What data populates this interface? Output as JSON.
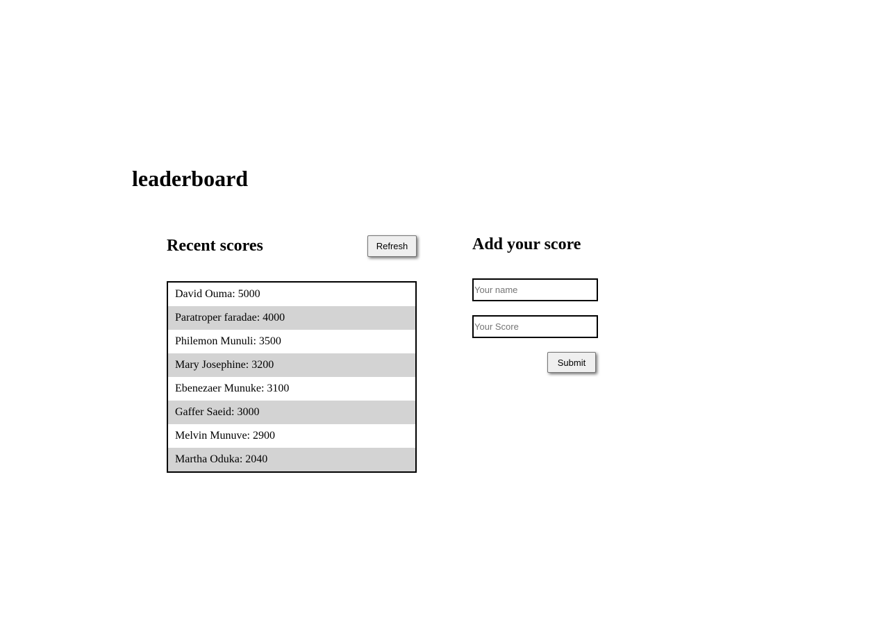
{
  "page": {
    "title": "leaderboard"
  },
  "recent_scores": {
    "title": "Recent scores",
    "refresh_label": "Refresh",
    "items": [
      {
        "text": "David Ouma: 5000"
      },
      {
        "text": "Paratroper faradae: 4000"
      },
      {
        "text": "Philemon Munuli: 3500"
      },
      {
        "text": "Mary Josephine: 3200"
      },
      {
        "text": "Ebenezaer Munuke: 3100"
      },
      {
        "text": "Gaffer Saeid: 3000"
      },
      {
        "text": "Melvin Munuve: 2900"
      },
      {
        "text": "Martha Oduka: 2040"
      }
    ],
    "row_alt_color": "#d3d3d3"
  },
  "add_score": {
    "title": "Add your score",
    "name_placeholder": "Your name",
    "name_value": "",
    "score_placeholder": "Your Score",
    "score_value": "",
    "submit_label": "Submit"
  }
}
